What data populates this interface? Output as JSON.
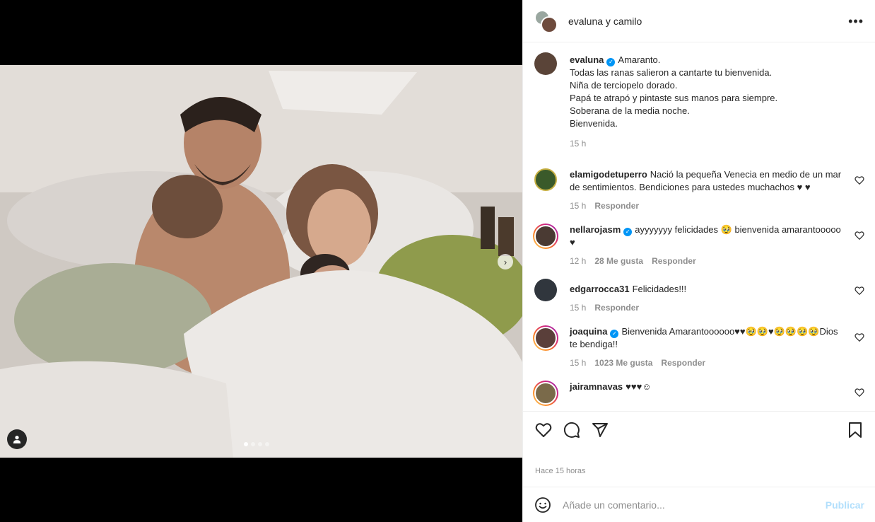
{
  "colors": {
    "accent": "#0095f6",
    "muted": "#8e8e8e",
    "border": "#efefef",
    "publish_disabled": "#b2dffc"
  },
  "post": {
    "header_title": "evaluna y camilo",
    "more_icon": "more-horizontal-icon",
    "carousel": {
      "slides": 4,
      "active_index": 0
    }
  },
  "caption": {
    "username": "evaluna",
    "verified": true,
    "lines": [
      "Amaranto.",
      "Todas las ranas salieron a cantarte tu bienvenida.",
      "Niña de terciopelo dorado.",
      "Papá te atrapó y pintaste sus manos para siempre.",
      "Soberana de la media noche.",
      "Bienvenida."
    ],
    "time": "15 h"
  },
  "comments": [
    {
      "username": "elamigodetuperro",
      "verified": false,
      "text": "Nació la pequeña Venecia en medio de un mar de sentimientos. Bendiciones para ustedes muchachos ♥ ♥",
      "time": "15 h",
      "likes": "",
      "reply": "Responder"
    },
    {
      "username": "nellarojasm",
      "verified": true,
      "text": "ayyyyyyy felicidades 🥹 bienvenida amarantooooo ♥",
      "time": "12 h",
      "likes": "28 Me gusta",
      "reply": "Responder"
    },
    {
      "username": "edgarrocca31",
      "verified": false,
      "text": "Felicidades!!!",
      "time": "15 h",
      "likes": "",
      "reply": "Responder"
    },
    {
      "username": "joaquina",
      "verified": true,
      "text": "Bienvenida Amarantoooooo♥♥🥹🥹♥🥹🥹🥹🥹Dios te bendiga!!",
      "time": "15 h",
      "likes": "1023 Me gusta",
      "reply": "Responder"
    },
    {
      "username": "jairamnavas",
      "verified": false,
      "text": "♥♥♥☺",
      "time": "",
      "likes": "",
      "reply": ""
    }
  ],
  "footer": {
    "timestamp": "Hace 15 horas",
    "comment_placeholder": "Añade un comentario...",
    "publish_label": "Publicar"
  }
}
